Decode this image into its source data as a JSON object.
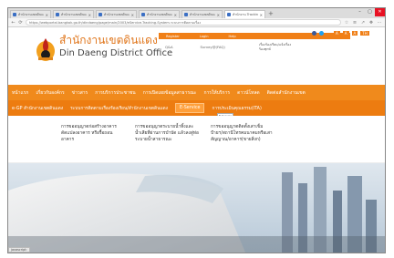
{
  "browser": {
    "tabs": [
      {
        "label": "สำนักงานเขตดินแดง - Facebook",
        "active": false
      },
      {
        "label": "สำนักงานเขตดินแดง",
        "active": false
      },
      {
        "label": "สำนักงานเขตดินแดง - Facebook",
        "active": false
      },
      {
        "label": "สำนักงานเขตดินแดง - Facebook",
        "active": false
      },
      {
        "label": "สำนักงานเขตดินแดง - สำนักงาน",
        "active": false
      },
      {
        "label": "สำนักงาน Tracking Sy...",
        "active": true
      }
    ],
    "new_tab": "+",
    "url": "https://webportal.bangkok.go.th/dindaeng/page/main/2003/eService-Tracking-System-ระบบการติดตามเรื่อง"
  },
  "site": {
    "title_th": "สำนักงานเขตดินแดง",
    "title_en": "Din Daeng District Office",
    "top_bar": [
      "Register",
      "Login",
      "",
      "Help"
    ],
    "faq": "Q&A",
    "survey": "Survey@(FAQ)",
    "hotline": "เรื่องร้องเรียน/แจ้งเรื่อง ร้องทุกข์",
    "font_controls": [
      "A",
      "A",
      "A",
      "TH"
    ]
  },
  "nav": {
    "row1": [
      "หน้าแรก",
      "เกี่ยวกับองค์กร",
      "ข่าวสาร",
      "การบริการประชาชน",
      "การเปิดเผยข้อมูลสาธารณะ",
      "การให้บริการ",
      "ดาวน์โหลด",
      "ติดต่อสำนักงานเขต"
    ],
    "row2_left": [
      "e-GP สำนักงานเขตดินแดง",
      "ระบบการติดตามเรื่องร้องเรียน/สำนักงานเขตดินแดง"
    ],
    "eservice": "E-Service",
    "row2_right": "การประเมินคุณธรรม(ITA)",
    "tooltip": "E-Service"
  },
  "dropdown": {
    "col1": "การขออนุญาตก่อสร้างอาคาร ดัดแปลงอาคาร หรือรื้อถอนอาคาร",
    "col2": "การขออนุญาตระบายน้ำทิ้งและน้ำเสียที่ผ่านการบำบัด แล้วลงสู่ท่อระบายน้ำสาธารณะ",
    "col3": "การขออนุญาตติดตั้งเสาเข็มป้ายฯ/สถานีโทรคมนาคมหรือเสาสัญญาณ/อาคาร(ขายสิ่งก)"
  },
  "status_text": "javascript:",
  "colors": {
    "brand_orange": "#f08a1c",
    "nav_dark_orange": "#ed7c10"
  }
}
